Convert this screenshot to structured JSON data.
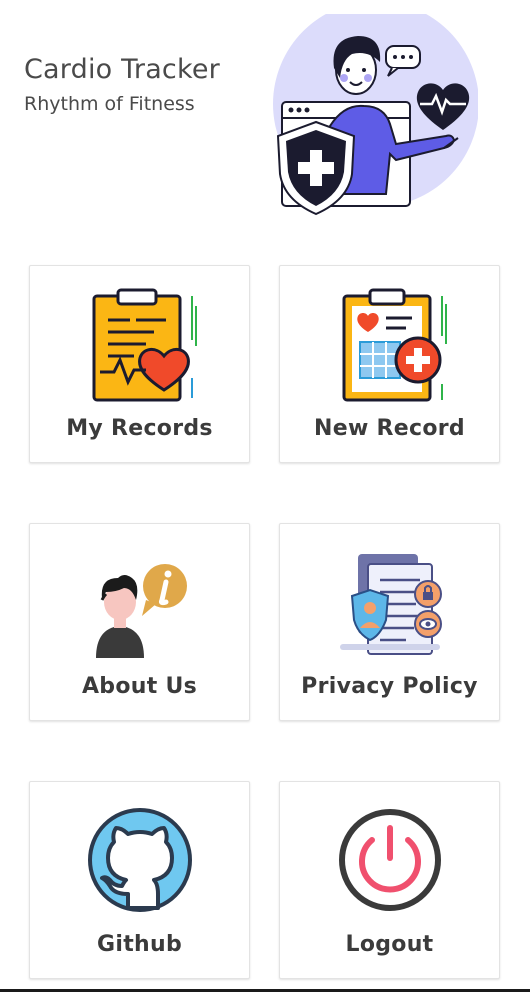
{
  "app": {
    "title": "Cardio Tracker",
    "subtitle": "Rhythm of Fitness"
  },
  "menu": {
    "items": [
      {
        "label": "My Records",
        "icon": "clipboard-heart-icon"
      },
      {
        "label": "New Record",
        "icon": "clipboard-add-icon"
      },
      {
        "label": "About Us",
        "icon": "person-info-icon"
      },
      {
        "label": "Privacy Policy",
        "icon": "privacy-document-icon"
      },
      {
        "label": "Github",
        "icon": "github-icon"
      },
      {
        "label": "Logout",
        "icon": "power-icon"
      }
    ]
  },
  "colors": {
    "heart_red": "#f04a2a",
    "clipboard_yellow": "#fbb614",
    "github_blue": "#6fc8f0",
    "power_pink": "#f0506e",
    "hero_circle": "#dcdcfb",
    "hero_purple": "#5e5ce6"
  }
}
